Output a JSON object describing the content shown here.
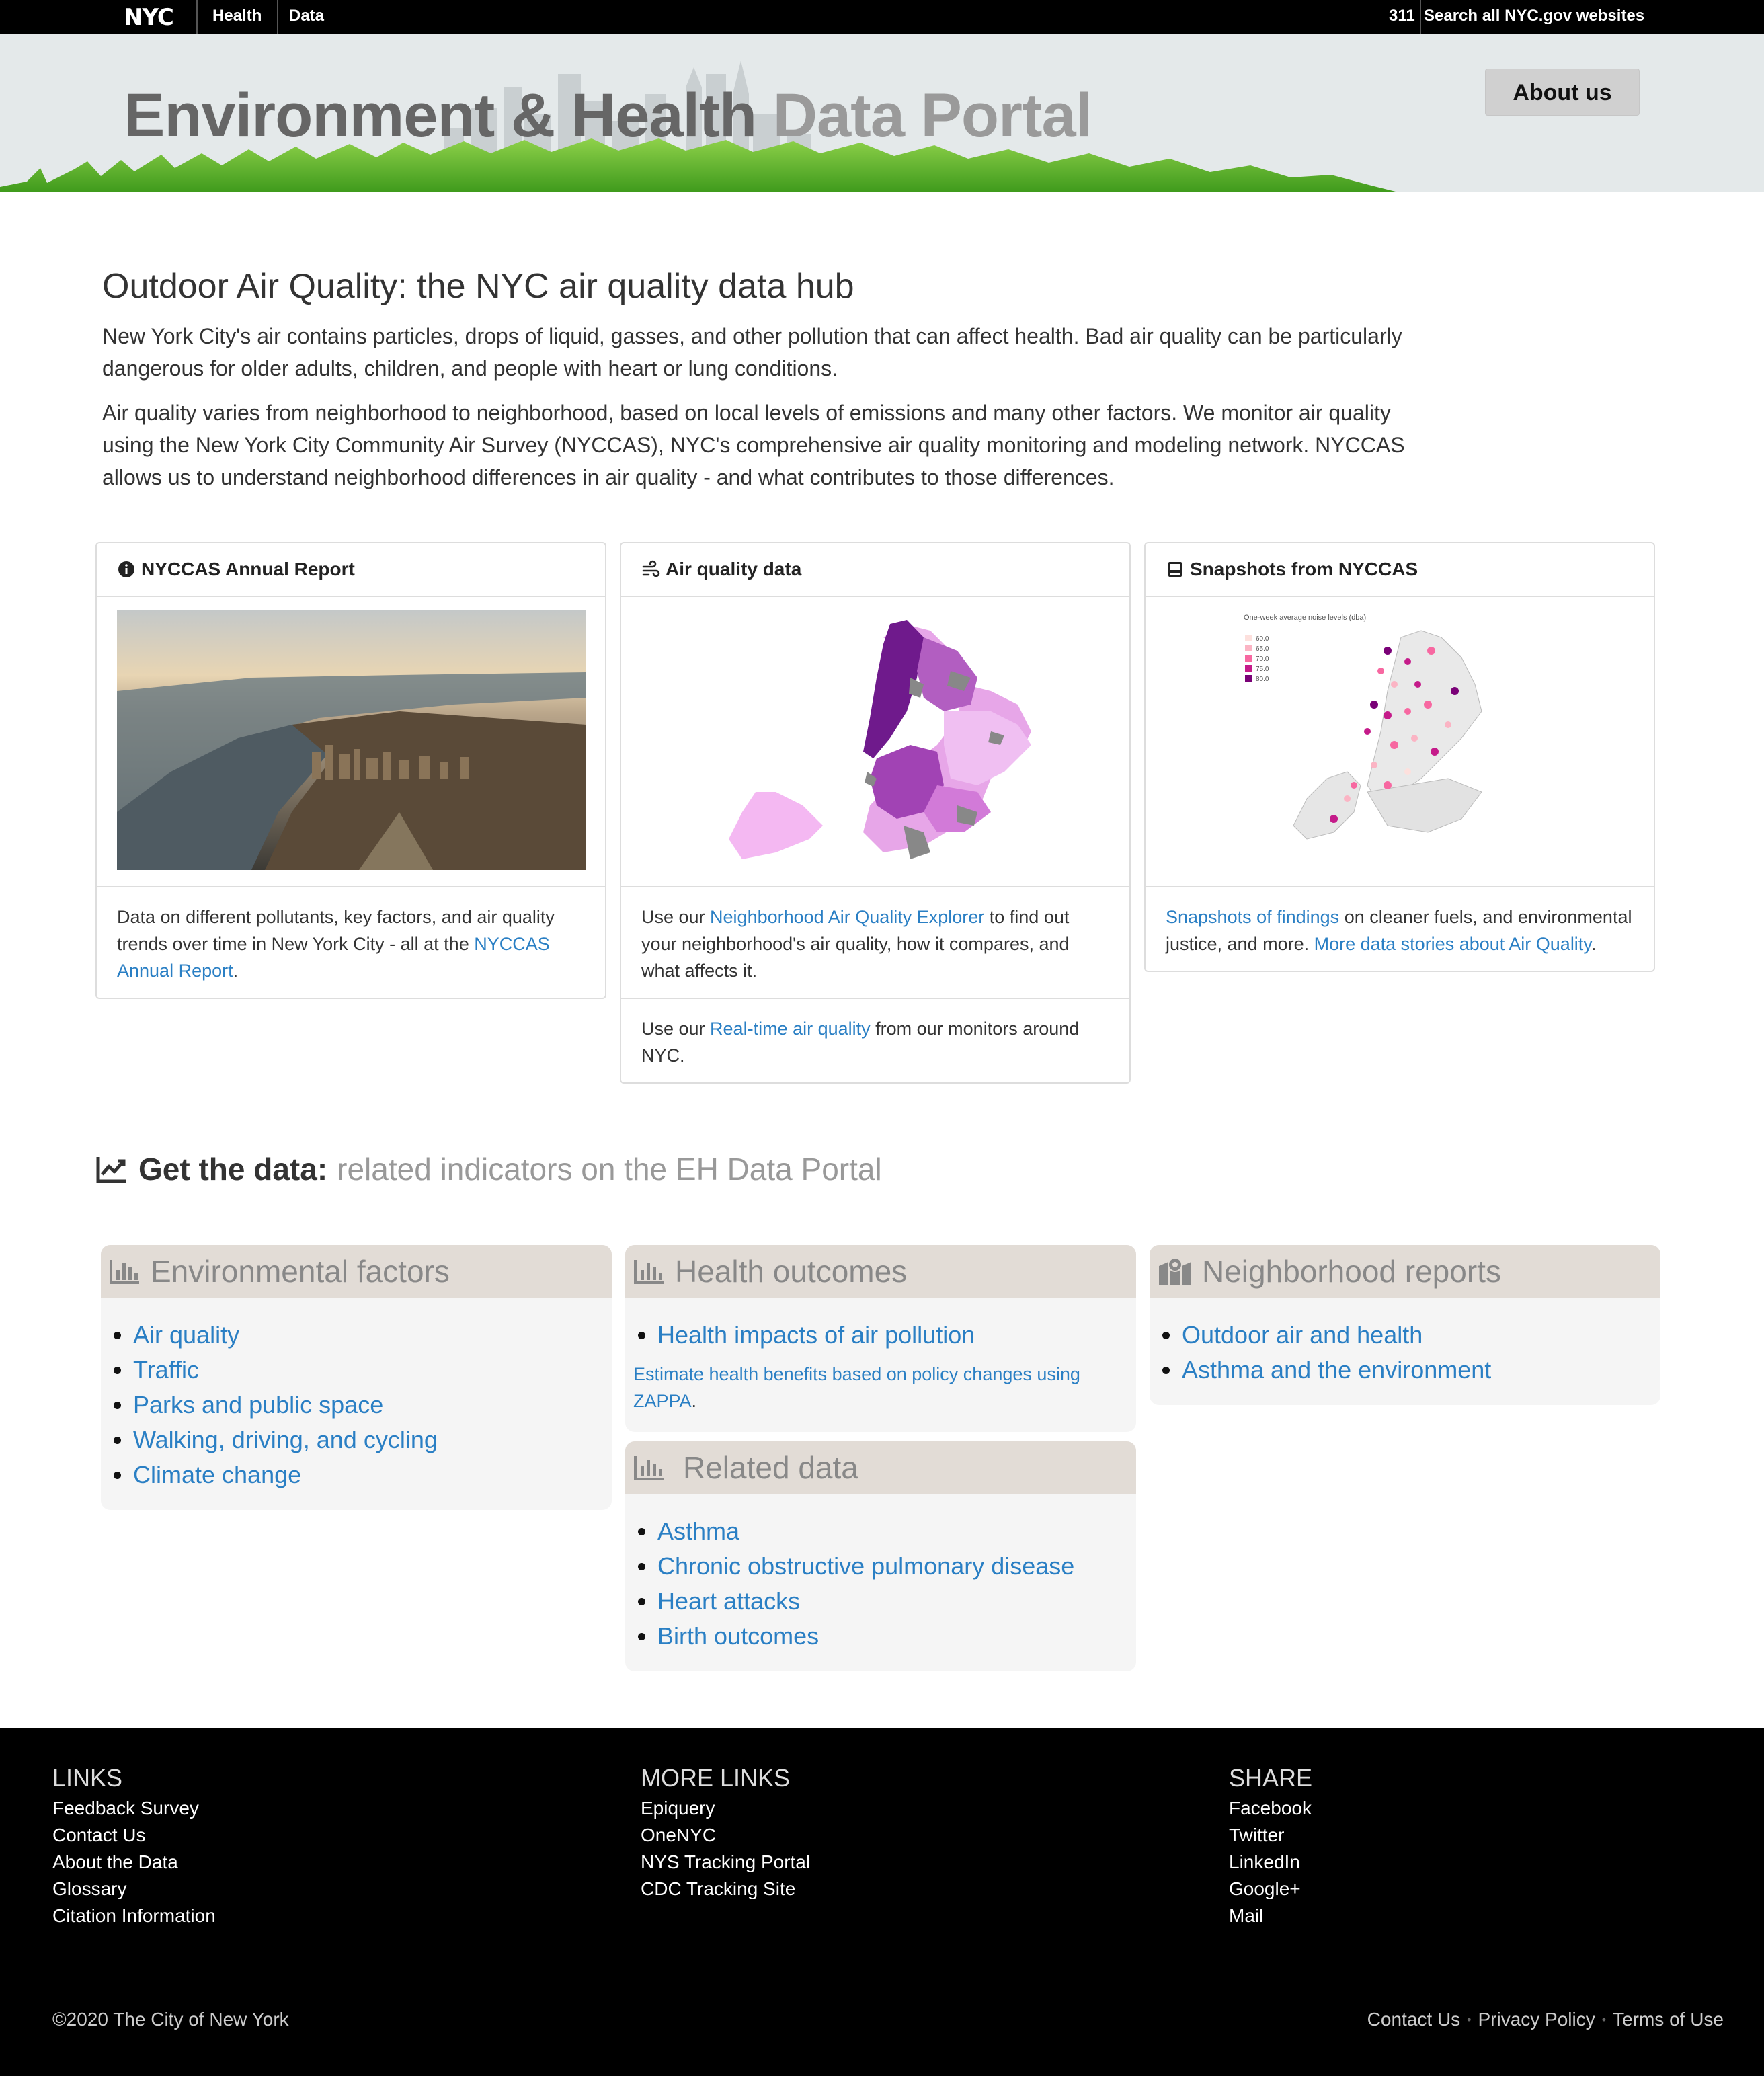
{
  "topbar": {
    "logo": "NYC",
    "nav": [
      "Health",
      "Data"
    ],
    "right_311": "311",
    "right_search": "Search all NYC.gov websites"
  },
  "banner": {
    "title_dark": "Environment & Health",
    "title_light": "Data Portal",
    "about_button": "About us"
  },
  "intro": {
    "heading": "Outdoor Air Quality: the NYC air quality data hub",
    "p1": "New York City's air contains particles, drops of liquid, gasses, and other pollution that can affect health. Bad air quality can be particularly dangerous for older adults, children, and people with heart or lung conditions.",
    "p2": "Air quality varies from neighborhood to neighborhood, based on local levels of emissions and many other factors. We monitor air quality using the New York City Community Air Survey (NYCCAS), NYC's comprehensive air quality monitoring and modeling network. NYCCAS allows us to understand neighborhood differences in air quality - and what contributes to those differences."
  },
  "cards": {
    "report": {
      "title": "NYCCAS Annual Report",
      "icon": "info-circle-icon",
      "body_pre": "Data on different pollutants, key factors, and air quality trends over time in New York City - all at the ",
      "body_link": "NYCCAS Annual Report",
      "body_post": "."
    },
    "aq": {
      "title": "Air quality data",
      "icon": "wind-icon",
      "body1_pre": "Use our ",
      "body1_link": "Neighborhood Air Quality Explorer",
      "body1_post": " to find out your neighborhood's air quality, how it compares, and what affects it.",
      "body2_pre": "Use our ",
      "body2_link": "Real-time air quality",
      "body2_post": " from our monitors around NYC."
    },
    "snap": {
      "title": "Snapshots from NYCCAS",
      "icon": "book-icon",
      "map_title": "One-week average noise levels (dba)",
      "legend": [
        "60.0",
        "65.0",
        "70.0",
        "75.0",
        "80.0"
      ],
      "body_link1": "Snapshots of findings",
      "body_mid": " on cleaner fuels, and environmental justice, and more. ",
      "body_link2": "More data stories about Air Quality",
      "body_post": "."
    }
  },
  "getdata": {
    "label": "Get the data:",
    "muted": "related indicators on the EH Data Portal"
  },
  "panels": {
    "env": {
      "title": "Environmental factors",
      "items": [
        "Air quality",
        "Traffic",
        "Parks and public space",
        "Walking, driving, and cycling",
        "Climate change"
      ]
    },
    "health": {
      "title": "Health outcomes",
      "items": [
        "Health impacts of air pollution"
      ],
      "note_link": "Estimate health benefits based on policy changes using ZAPPA",
      "note_post": "."
    },
    "related": {
      "title": "Related data",
      "items": [
        "Asthma",
        "Chronic obstructive pulmonary disease",
        "Heart attacks",
        "Birth outcomes"
      ]
    },
    "neigh": {
      "title": "Neighborhood reports",
      "items": [
        "Outdoor air and health",
        "Asthma and the environment"
      ]
    }
  },
  "footer": {
    "links": {
      "title": "LINKS",
      "items": [
        "Feedback Survey",
        "Contact Us",
        "About the Data",
        "Glossary",
        "Citation Information"
      ]
    },
    "more": {
      "title": "MORE LINKS",
      "items": [
        "Epiquery",
        "OneNYC",
        "NYS Tracking Portal",
        "CDC Tracking Site"
      ]
    },
    "share": {
      "title": "SHARE",
      "items": [
        "Facebook",
        "Twitter",
        "LinkedIn",
        "Google+",
        "Mail"
      ]
    },
    "copyright": "©2020 The City of New York",
    "bottom_links": [
      "Contact Us",
      "Privacy Policy",
      "Terms of Use"
    ]
  },
  "colors": {
    "link": "#2a7fc4",
    "panel_header": "#e2dcd6",
    "panel_bg": "#f5f5f5",
    "banner_bg": "#e4e9ea"
  }
}
